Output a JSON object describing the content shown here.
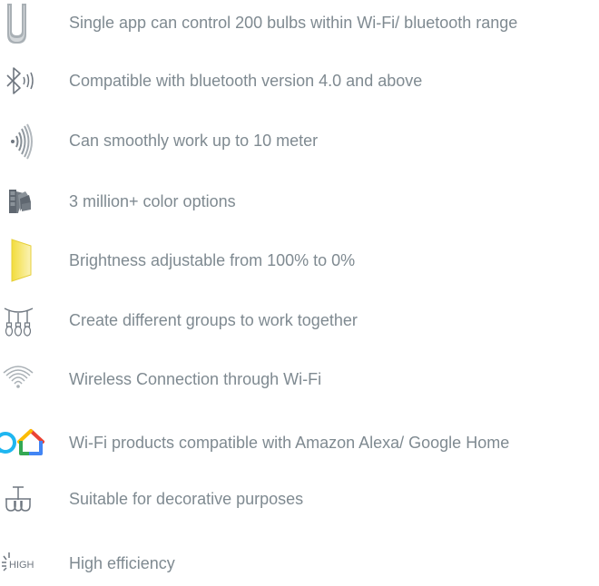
{
  "features": [
    {
      "icon": "bulbs-tower-icon",
      "text": "Single app can control 200 bulbs within Wi-Fi/ bluetooth range"
    },
    {
      "icon": "bluetooth-icon",
      "text": "Compatible with bluetooth version 4.0 and above"
    },
    {
      "icon": "signal-waves-icon",
      "text": "Can smoothly work up to 10 meter"
    },
    {
      "icon": "color-swatch-icon",
      "text": "3 million+ color options"
    },
    {
      "icon": "brightness-panel-icon",
      "text": "Brightness adjustable from 100% to 0%"
    },
    {
      "icon": "bulb-group-icon",
      "text": "Create different groups to work together"
    },
    {
      "icon": "wifi-icon",
      "text": "Wireless Connection through Wi-Fi"
    },
    {
      "icon": "alexa-google-home-icon",
      "text": "Wi-Fi products compatible with Amazon Alexa/ Google Home"
    },
    {
      "icon": "chandelier-icon",
      "text": "Suitable for decorative purposes"
    },
    {
      "icon": "high-efficiency-icon",
      "text": "High efficiency"
    }
  ],
  "badges": {
    "high": "HIGH"
  },
  "colors": {
    "text": "#7f8a91",
    "icon_gray": "#a9b0b5",
    "icon_dark": "#6f7780",
    "brightness_yellow": "#f4e25a",
    "alexa_blue": "#1fb6f0",
    "google_red": "#ea4335",
    "google_yellow": "#fbbc05",
    "google_green": "#34a853",
    "google_blue": "#4285f4"
  }
}
